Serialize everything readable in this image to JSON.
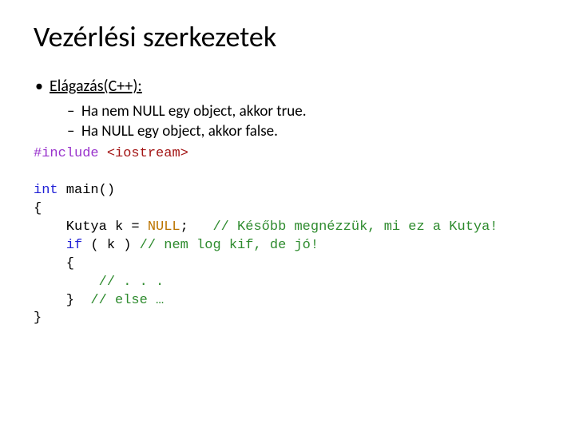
{
  "title": "Vezérlési szerkezetek",
  "bullet1": "Elágazás(C++):",
  "sub1": "Ha nem NULL egy object, akkor true.",
  "sub2": "Ha NULL egy object, akkor false.",
  "code": {
    "l1a": "#include",
    "l1b": "<iostream>",
    "l2a": "int",
    "l2b": " main()",
    "l3": "{",
    "l4a": "    Kutya k = ",
    "l4b": "NULL",
    "l4c": ";   ",
    "l4d": "// Később megnézzük, mi ez a Kutya!",
    "l5a": "    ",
    "l5b": "if",
    "l5c": " ( k ) ",
    "l5d": "// nem log kif, de jó!",
    "l6": "    {",
    "l7a": "        ",
    "l7b": "// . . .",
    "l8a": "    }  ",
    "l8b": "// else …",
    "l9": "}"
  }
}
